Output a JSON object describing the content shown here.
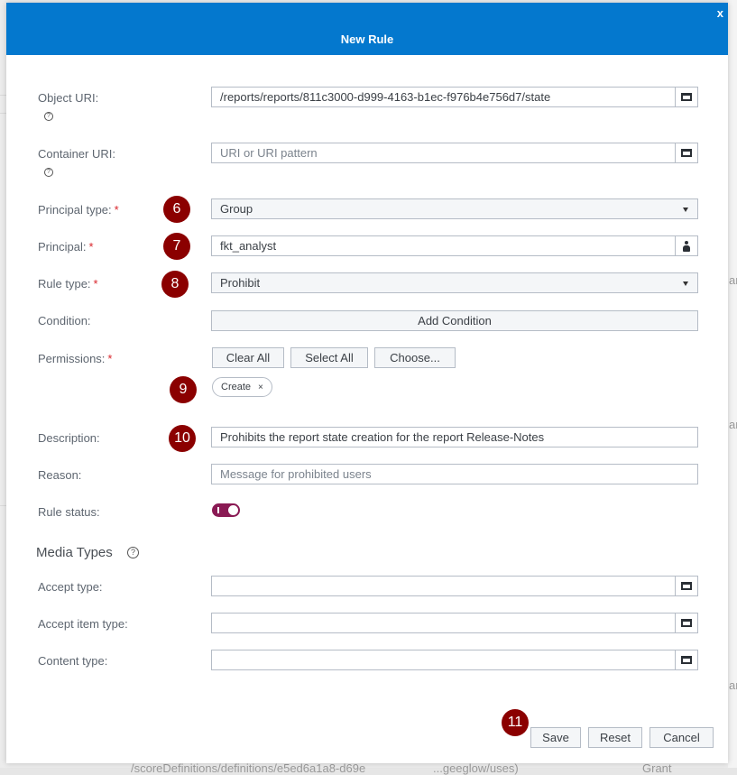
{
  "dialog": {
    "title": "New Rule",
    "close_label": "x"
  },
  "fields": {
    "object_uri": {
      "label": "Object URI:",
      "value": "/reports/reports/811c3000-d999-4163-b1ec-f976b4e756d7/state",
      "help": "?"
    },
    "container_uri": {
      "label": "Container URI:",
      "placeholder": "URI or URI pattern",
      "help": "?"
    },
    "principal_type": {
      "label": "Principal type:",
      "required": "*",
      "value": "Group"
    },
    "principal": {
      "label": "Principal:",
      "required": "*",
      "value": "fkt_analyst"
    },
    "rule_type": {
      "label": "Rule type:",
      "required": "*",
      "value": "Prohibit"
    },
    "condition": {
      "label": "Condition:",
      "button": "Add Condition"
    },
    "permissions": {
      "label": "Permissions:",
      "required": "*",
      "buttons": [
        "Clear All",
        "Select All",
        "Choose..."
      ],
      "chips": [
        {
          "label": "Create",
          "remove": "×"
        }
      ]
    },
    "description": {
      "label": "Description:",
      "value": "Prohibits the report state creation for the report Release-Notes"
    },
    "reason": {
      "label": "Reason:",
      "placeholder": "Message for prohibited users"
    },
    "rule_status": {
      "label": "Rule status:",
      "enabled": true
    }
  },
  "media_types": {
    "title": "Media Types",
    "help": "?",
    "accept_type": {
      "label": "Accept type:",
      "value": ""
    },
    "accept_item_type": {
      "label": "Accept item type:",
      "value": ""
    },
    "content_type": {
      "label": "Content type:",
      "value": ""
    }
  },
  "footer": {
    "save": "Save",
    "reset": "Reset",
    "cancel": "Cancel"
  },
  "annotations": [
    "6",
    "7",
    "8",
    "9",
    "10",
    "11"
  ],
  "background": {
    "fragment_right": "ar",
    "fragment_bottom_1": "/scoreDefinitions/definitions/e5ed6a1a8-d69e",
    "fragment_bottom_2": "...geeglow/uses)",
    "fragment_bottom_3": "Grant"
  }
}
